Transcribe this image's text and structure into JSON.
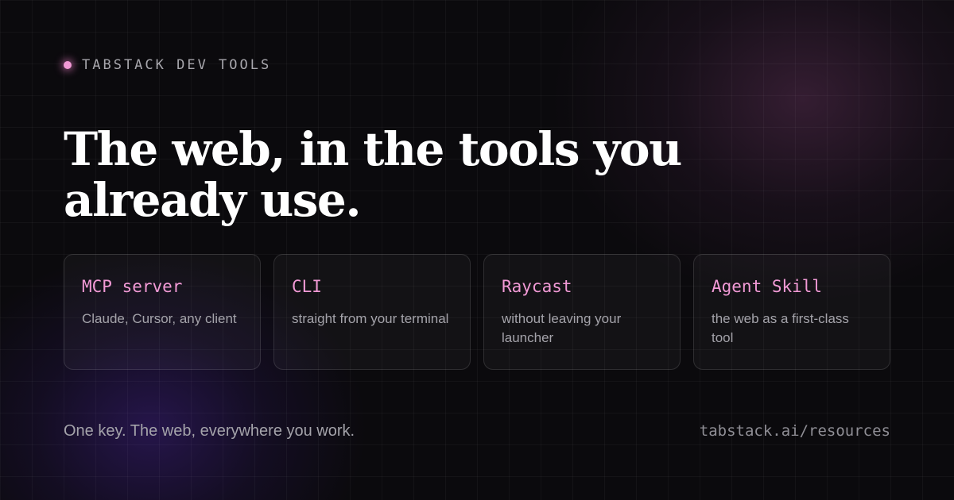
{
  "brand": {
    "eyebrow": "TABSTACK DEV TOOLS",
    "accent_color": "#f29ad6"
  },
  "headline": "The web, in the tools you already use.",
  "cards": [
    {
      "title": "MCP server",
      "description": "Claude, Cursor, any client"
    },
    {
      "title": "CLI",
      "description": "straight from your terminal"
    },
    {
      "title": "Raycast",
      "description": "without leaving your launcher"
    },
    {
      "title": "Agent Skill",
      "description": "the web as a first-class tool"
    }
  ],
  "footer": {
    "tagline": "One key. The web, everywhere you work.",
    "url": "tabstack.ai/resources"
  }
}
